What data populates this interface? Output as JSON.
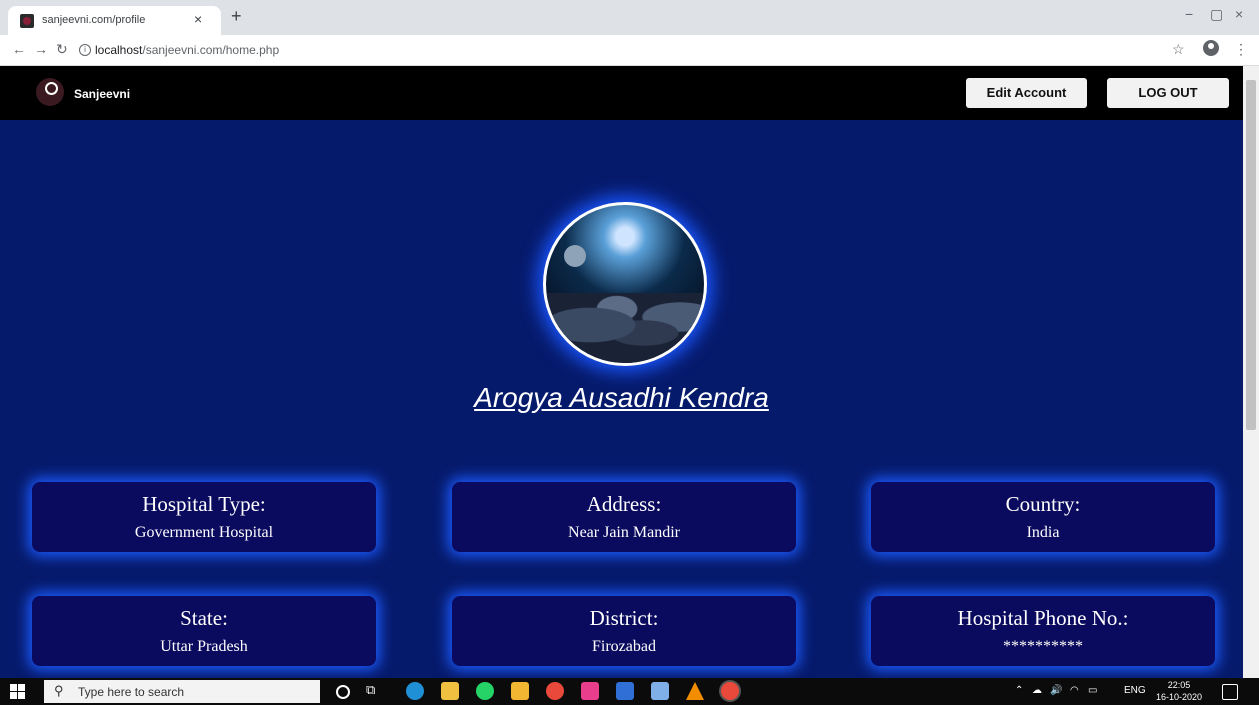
{
  "browser": {
    "tab_title": "sanjeevni.com/profile",
    "tab_close": "×",
    "new_tab": "+",
    "url_host": "localhost",
    "url_path": "/sanjeevni.com/home.php",
    "window_minimize": "−",
    "window_maximize": "▢",
    "window_close": "×"
  },
  "navbar": {
    "brand": "Sanjeevni",
    "edit_account": "Edit Account",
    "logout": "LOG OUT"
  },
  "profile": {
    "name": "Arogya Ausadhi Kendra"
  },
  "cards": [
    {
      "label": "Hospital Type:",
      "value": "Government Hospital"
    },
    {
      "label": "Address:",
      "value": "Near Jain Mandir"
    },
    {
      "label": "Country:",
      "value": "India"
    },
    {
      "label": "State:",
      "value": "Uttar Pradesh"
    },
    {
      "label": "District:",
      "value": "Firozabad"
    },
    {
      "label": "Hospital Phone No.:",
      "value": "**********"
    }
  ],
  "taskbar": {
    "search_placeholder": "Type here to search",
    "language": "ENG",
    "time": "22:05",
    "date": "16-10-2020"
  },
  "colors": {
    "page_background": "#061a6b",
    "card_background": "#0a0a5e",
    "card_glow": "#1c5cff",
    "navbar_background": "#000000"
  }
}
